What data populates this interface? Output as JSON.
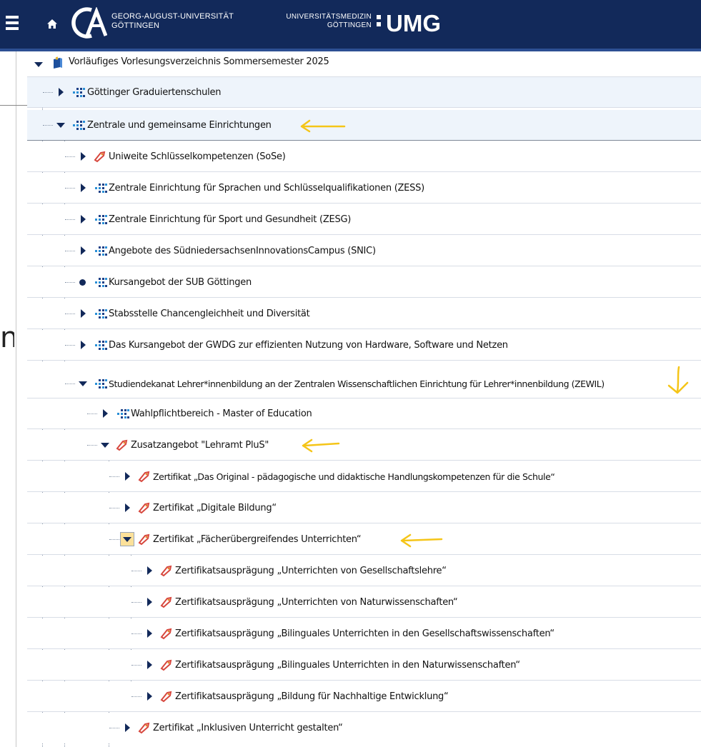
{
  "header": {
    "university_line1": "GEORG-AUGUST-UNIVERSITÄT",
    "university_line2": "GÖTTINGEN",
    "umg_line1": "UNIVERSITÄTSMEDIZIN",
    "umg_line2": "GÖTTINGEN",
    "umg_logo": "UMG",
    "menu_icon": "hamburger-menu-icon",
    "home_icon": "home-icon"
  },
  "tree": {
    "root": "Vorläufiges Vorlesungsverzeichnis Sommersemester 2025",
    "items": [
      {
        "label": "Göttinger Graduiertenschulen",
        "icon": "institution-dots-icon",
        "state": "collapsed"
      },
      {
        "label": "Zentrale und gemeinsame Einrichtungen",
        "icon": "institution-dots-icon",
        "state": "expanded"
      },
      {
        "label": "Uniweite Schlüsselkompetenzen (SoSe)",
        "icon": "module-tag-icon",
        "state": "collapsed"
      },
      {
        "label": "Zentrale Einrichtung für Sprachen und Schlüsselqualifikationen (ZESS)",
        "icon": "institution-dots-icon",
        "state": "collapsed"
      },
      {
        "label": "Zentrale Einrichtung für Sport und Gesundheit (ZESG)",
        "icon": "institution-dots-icon",
        "state": "collapsed"
      },
      {
        "label": "Angebote des SüdniedersachsenInnovationsCampus (SNIC)",
        "icon": "institution-dots-icon",
        "state": "collapsed"
      },
      {
        "label": "Kursangebot der SUB Göttingen",
        "icon": "institution-dots-icon",
        "state": "leaf"
      },
      {
        "label": "Stabsstelle Chancengleichheit und Diversität",
        "icon": "institution-dots-icon",
        "state": "collapsed"
      },
      {
        "label": "Das Kursangebot der GWDG zur effizienten Nutzung von Hardware, Software und Netzen",
        "icon": "institution-dots-icon",
        "state": "collapsed"
      },
      {
        "label": "Studiendekanat Lehrer*innenbildung an der Zentralen Wissenschaftlichen Einrichtung für Lehrer*innenbildung (ZEWIL)",
        "icon": "institution-dots-icon",
        "state": "expanded"
      },
      {
        "label": "Wahlpflichtbereich - Master of Education",
        "icon": "institution-dots-icon",
        "state": "collapsed"
      },
      {
        "label": "Zusatzangebot \"Lehramt PluS\"",
        "icon": "module-tag-icon",
        "state": "expanded"
      },
      {
        "label": "Zertifikat „Das Original - pädagogische und didaktische Handlungskompetenzen für die Schule“",
        "icon": "module-tag-icon",
        "state": "collapsed"
      },
      {
        "label": "Zertifikat „Digitale Bildung“",
        "icon": "module-tag-icon",
        "state": "collapsed"
      },
      {
        "label": "Zertifikat „Fächerübergreifendes Unterrichten“",
        "icon": "module-tag-icon",
        "state": "expanded"
      },
      {
        "label": "Zertifikatsausprägung „Unterrichten von Gesellschaftslehre“",
        "icon": "module-tag-icon",
        "state": "collapsed"
      },
      {
        "label": "Zertifikatsausprägung „Unterrichten von Naturwissenschaften“",
        "icon": "module-tag-icon",
        "state": "collapsed"
      },
      {
        "label": "Zertifikatsausprägung „Bilinguales Unterrichten in den Gesellschaftswissenschaften“",
        "icon": "module-tag-icon",
        "state": "collapsed"
      },
      {
        "label": "Zertifikatsausprägung „Bilinguales Unterrichten in den Naturwissenschaften“",
        "icon": "module-tag-icon",
        "state": "collapsed"
      },
      {
        "label": "Zertifikatsausprägung „Bildung für Nachhaltige Entwicklung“",
        "icon": "module-tag-icon",
        "state": "collapsed"
      },
      {
        "label": "Zertifikat „Inklusiven Unterricht gestalten“",
        "icon": "module-tag-icon",
        "state": "collapsed"
      }
    ]
  },
  "background": {
    "glyph": "n"
  },
  "colors": {
    "header_bg": "#12295a",
    "arrow": "#12295a",
    "highlight_arrow": "#fce19a",
    "annotation": "#f5c518",
    "tag_icon": "#d7473d"
  }
}
